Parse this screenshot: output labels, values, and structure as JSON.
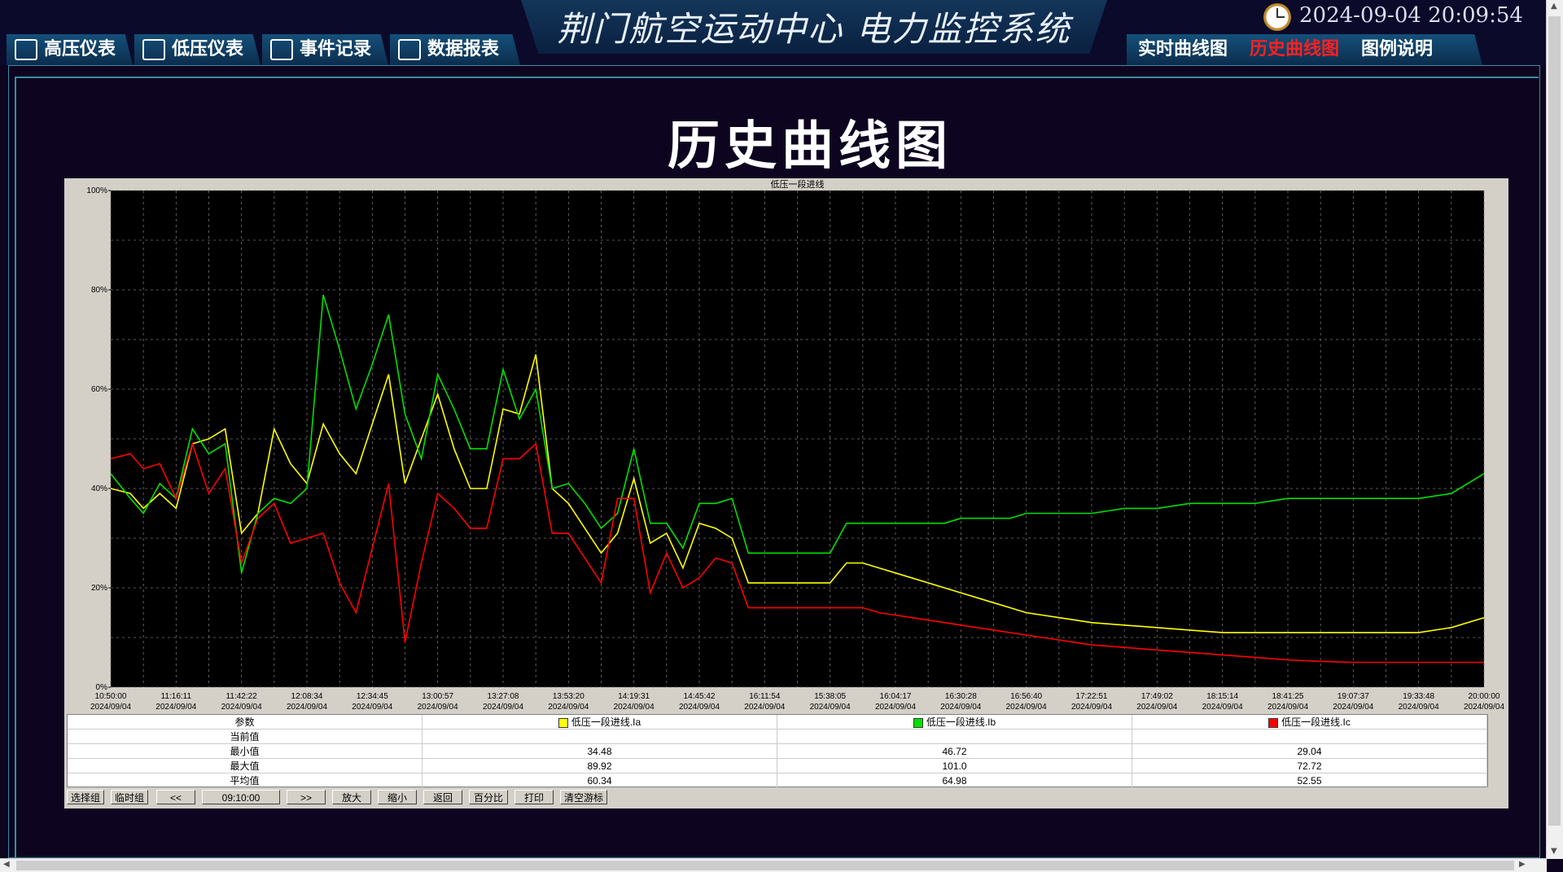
{
  "header": {
    "system_title": "荆门航空运动中心  电力监控系统",
    "clock": "2024-09-04 20:09:54"
  },
  "nav": {
    "left_tabs": [
      {
        "label": "高压仪表",
        "icon": "monitor-chart-icon"
      },
      {
        "label": "低压仪表",
        "icon": "monitor-chart-icon"
      },
      {
        "label": "事件记录",
        "icon": "list-icon"
      },
      {
        "label": "数据报表",
        "icon": "bar-chart-icon"
      }
    ],
    "right_tabs": [
      {
        "label": "实时曲线图",
        "active": false
      },
      {
        "label": "历史曲线图",
        "active": true
      },
      {
        "label": "图例说明",
        "active": false
      }
    ]
  },
  "page": {
    "heading": "历史曲线图"
  },
  "chart_data": {
    "type": "line",
    "title": "低压一段进线",
    "ylim": [
      0,
      100
    ],
    "y_ticks": [
      "0%",
      "20%",
      "40%",
      "60%",
      "80%",
      "100%"
    ],
    "x_tick_times": [
      "10:50:00",
      "11:16:11",
      "11:42:22",
      "12:08:34",
      "12:34:45",
      "13:00:57",
      "13:27:08",
      "13:53:20",
      "14:19:31",
      "14:45:42",
      "16:11:54",
      "15:38:05",
      "16:04:17",
      "16:30:28",
      "16:56:40",
      "17:22:51",
      "17:49:02",
      "18:15:14",
      "18:41:25",
      "19:07:37",
      "19:33:48",
      "20:00:00"
    ],
    "x_tick_date": "2024/09/04",
    "grid": true,
    "series": [
      {
        "name": "低压一段进线.Ia",
        "color": "#ffff00",
        "x": [
          0,
          0.3,
          0.5,
          0.75,
          1.0,
          1.25,
          1.5,
          1.75,
          2.0,
          2.25,
          2.5,
          2.75,
          3.0,
          3.25,
          3.5,
          3.75,
          4.0,
          4.25,
          4.5,
          4.75,
          5.0,
          5.25,
          5.5,
          5.75,
          6.0,
          6.25,
          6.5,
          6.75,
          7.0,
          7.25,
          7.5,
          7.75,
          8.0,
          8.25,
          8.5,
          8.75,
          9.0,
          9.25,
          9.5,
          9.75,
          10.0,
          10.25,
          10.5,
          10.75,
          11.0,
          11.25,
          11.5,
          11.75,
          12.0,
          12.25,
          12.5,
          12.75,
          13.0,
          13.25,
          13.5,
          13.75,
          14.0,
          14.25,
          14.5,
          14.75,
          15.0,
          15.5,
          16.0,
          16.5,
          17.0,
          17.5,
          18.0,
          18.5,
          19.0,
          19.5,
          20.0,
          20.5,
          21.0
        ],
        "values": [
          40,
          39,
          36,
          39,
          36,
          49,
          50,
          52,
          31,
          35,
          52,
          45,
          41,
          53,
          47,
          43,
          53,
          63,
          41,
          50,
          59,
          48,
          40,
          40,
          56,
          55,
          67,
          40,
          37,
          32,
          27,
          31,
          42,
          29,
          31,
          24,
          33,
          32,
          30,
          21,
          21,
          21,
          21,
          21,
          21,
          25,
          25,
          24,
          23,
          22,
          21,
          20,
          19,
          18,
          17,
          16,
          15,
          14.5,
          14,
          13.5,
          13,
          12.5,
          12,
          11.5,
          11,
          11,
          11,
          11,
          11,
          11,
          11,
          12,
          14
        ]
      },
      {
        "name": "低压一段进线.Ib",
        "color": "#00e000",
        "x": [
          0,
          0.3,
          0.5,
          0.75,
          1.0,
          1.25,
          1.5,
          1.75,
          2.0,
          2.25,
          2.5,
          2.75,
          3.0,
          3.25,
          3.5,
          3.75,
          4.0,
          4.25,
          4.5,
          4.75,
          5.0,
          5.25,
          5.5,
          5.75,
          6.0,
          6.25,
          6.5,
          6.75,
          7.0,
          7.25,
          7.5,
          7.75,
          8.0,
          8.25,
          8.5,
          8.75,
          9.0,
          9.25,
          9.5,
          9.75,
          10.0,
          10.25,
          10.5,
          10.75,
          11.0,
          11.25,
          11.5,
          11.75,
          12.0,
          12.25,
          12.5,
          12.75,
          13.0,
          13.25,
          13.5,
          13.75,
          14.0,
          14.25,
          14.5,
          14.75,
          15.0,
          15.5,
          16.0,
          16.5,
          17.0,
          17.5,
          18.0,
          18.5,
          19.0,
          19.5,
          20.0,
          20.5,
          21.0
        ],
        "values": [
          43,
          38,
          35,
          41,
          38,
          52,
          47,
          49,
          23,
          35,
          38,
          37,
          40,
          79,
          68,
          56,
          65,
          75,
          55,
          46,
          63,
          56,
          48,
          48,
          64,
          54,
          60,
          40,
          41,
          37,
          32,
          35,
          48,
          33,
          33,
          28,
          37,
          37,
          38,
          27,
          27,
          27,
          27,
          27,
          27,
          33,
          33,
          33,
          33,
          33,
          33,
          33,
          34,
          34,
          34,
          34,
          35,
          35,
          35,
          35,
          35,
          36,
          36,
          37,
          37,
          37,
          38,
          38,
          38,
          38,
          38,
          39,
          43
        ]
      },
      {
        "name": "低压一段进线.Ic",
        "color": "#ff0000",
        "x": [
          0,
          0.3,
          0.5,
          0.75,
          1.0,
          1.25,
          1.5,
          1.75,
          2.0,
          2.25,
          2.5,
          2.75,
          3.0,
          3.25,
          3.5,
          3.75,
          4.0,
          4.25,
          4.5,
          4.75,
          5.0,
          5.25,
          5.5,
          5.75,
          6.0,
          6.25,
          6.5,
          6.75,
          7.0,
          7.25,
          7.5,
          7.75,
          8.0,
          8.25,
          8.5,
          8.75,
          9.0,
          9.25,
          9.5,
          9.75,
          10.0,
          10.25,
          10.5,
          10.75,
          11.0,
          11.25,
          11.5,
          11.75,
          12.0,
          12.25,
          12.5,
          12.75,
          13.0,
          13.25,
          13.5,
          13.75,
          14.0,
          14.25,
          14.5,
          14.75,
          15.0,
          15.5,
          16.0,
          16.5,
          17.0,
          17.5,
          18.0,
          18.5,
          19.0,
          19.5,
          20.0,
          20.5,
          21.0
        ],
        "values": [
          46,
          47,
          44,
          45,
          38,
          49,
          39,
          44,
          25,
          34,
          37,
          29,
          30,
          31,
          21,
          15,
          28,
          41,
          9,
          25,
          39,
          36,
          32,
          32,
          46,
          46,
          49,
          31,
          31,
          26,
          21,
          38,
          38,
          19,
          27,
          20,
          22,
          26,
          25,
          16,
          16,
          16,
          16,
          16,
          16,
          16,
          16,
          15,
          14.5,
          14,
          13.5,
          13,
          12.5,
          12,
          11.5,
          11,
          10.5,
          10,
          9.5,
          9,
          8.5,
          8,
          7.5,
          7,
          6.5,
          6,
          5.5,
          5.2,
          5,
          5,
          5,
          5,
          5
        ]
      }
    ]
  },
  "stats_table": {
    "header": [
      "参数",
      "低压一段进线.Ia",
      "低压一段进线.Ib",
      "低压一段进线.Ic"
    ],
    "rows": [
      {
        "label": "当前值",
        "values": [
          "",
          "",
          ""
        ]
      },
      {
        "label": "最小值",
        "values": [
          "34.48",
          "46.72",
          "29.04"
        ]
      },
      {
        "label": "最大值",
        "values": [
          "89.92",
          "101.0",
          "72.72"
        ]
      },
      {
        "label": "平均值",
        "values": [
          "60.34",
          "64.98",
          "52.55"
        ]
      }
    ]
  },
  "toolbar": {
    "select_group": "选择组",
    "temp_group": "临时组",
    "prev": "<<",
    "time_span": "09:10:00",
    "next": ">>",
    "zoom_in": "放大",
    "zoom_out": "缩小",
    "back": "返回",
    "percent": "百分比",
    "print": "打印",
    "clear_cursor": "清空游标"
  },
  "colors": {
    "background": "#0d0520",
    "plot_bg": "#000000",
    "tab_active_text": "#ff2020"
  }
}
